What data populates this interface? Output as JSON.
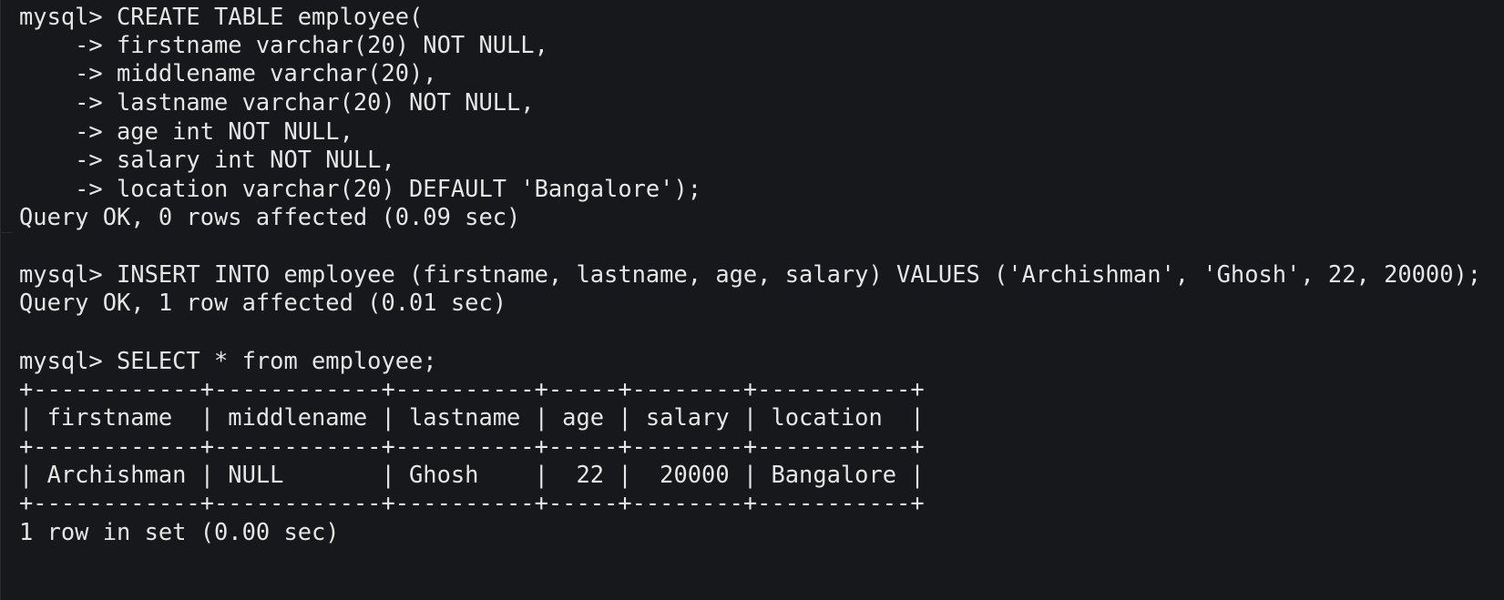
{
  "terminal": {
    "create": {
      "prompt": "mysql> CREATE TABLE employee(",
      "cont_firstname": "    -> firstname varchar(20) NOT NULL,",
      "cont_middlename": "    -> middlename varchar(20),",
      "cont_lastname": "    -> lastname varchar(20) NOT NULL,",
      "cont_age": "    -> age int NOT NULL,",
      "cont_salary": "    -> salary int NOT NULL,",
      "cont_location": "    -> location varchar(20) DEFAULT 'Bangalore');",
      "result": "Query OK, 0 rows affected (0.09 sec)"
    },
    "insert": {
      "prompt": "mysql> INSERT INTO employee (firstname, lastname, age, salary) VALUES ('Archishman', 'Ghosh', 22, 20000);",
      "result": "Query OK, 1 row affected (0.01 sec)"
    },
    "select": {
      "prompt": "mysql> SELECT * from employee;",
      "border_top": "+------------+------------+----------+-----+--------+-----------+",
      "header_row": "| firstname  | middlename | lastname | age | salary | location  |",
      "border_mid": "+------------+------------+----------+-----+--------+-----------+",
      "data_row": "| Archishman | NULL       | Ghosh    |  22 |  20000 | Bangalore |",
      "border_bottom": "+------------+------------+----------+-----+--------+-----------+",
      "result": "1 row in set (0.00 sec)"
    }
  }
}
